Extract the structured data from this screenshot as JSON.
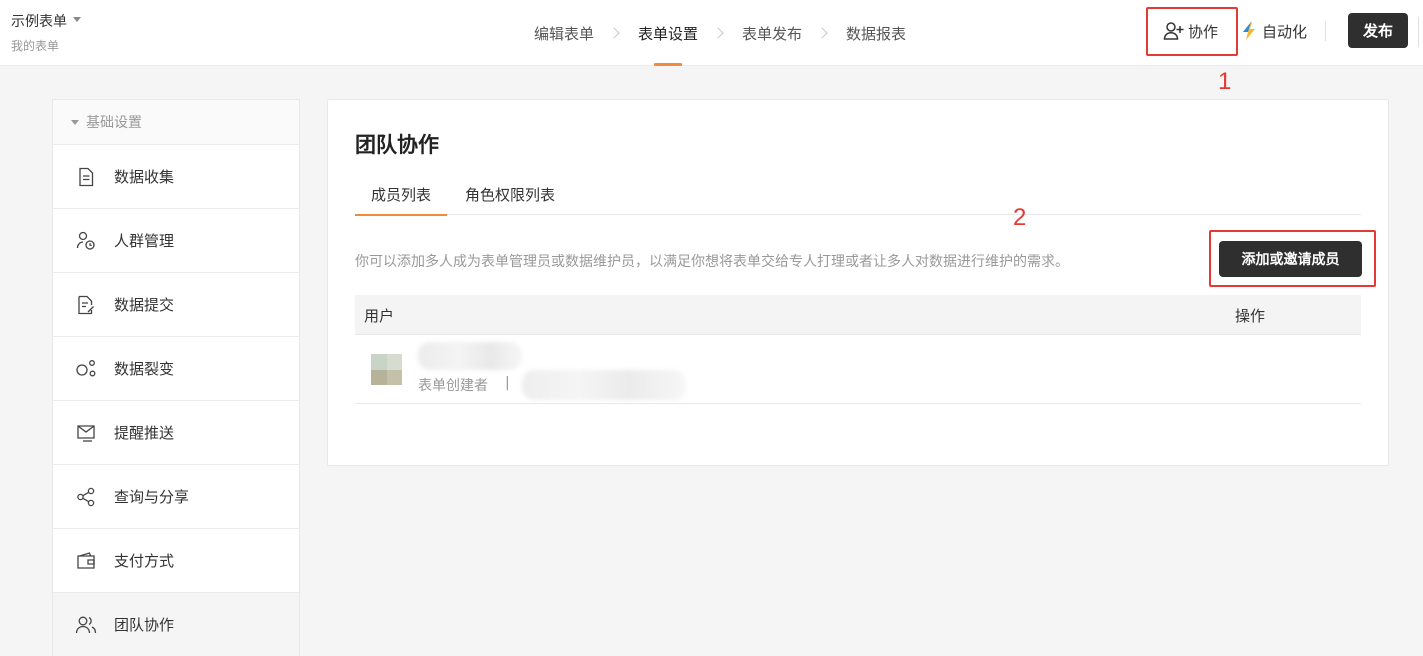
{
  "header": {
    "form_title": "示例表单",
    "form_subtitle": "我的表单",
    "steps": [
      "编辑表单",
      "表单设置",
      "表单发布",
      "数据报表"
    ],
    "active_step": "表单设置",
    "collab_label": "协作",
    "automation_label": "自动化",
    "publish_label": "发布"
  },
  "annotations": {
    "mark_1": "1",
    "mark_2": "2",
    "color": "#e53935"
  },
  "sidebar": {
    "group_label": "基础设置",
    "items": [
      {
        "label": "数据收集",
        "icon": "document-icon"
      },
      {
        "label": "人群管理",
        "icon": "user-clock-icon"
      },
      {
        "label": "数据提交",
        "icon": "document-edit-icon"
      },
      {
        "label": "数据裂变",
        "icon": "nodes-icon"
      },
      {
        "label": "提醒推送",
        "icon": "envelope-icon"
      },
      {
        "label": "查询与分享",
        "icon": "share-icon"
      },
      {
        "label": "支付方式",
        "icon": "wallet-icon"
      },
      {
        "label": "团队协作",
        "icon": "team-icon"
      }
    ],
    "active_item": "团队协作"
  },
  "main": {
    "title": "团队协作",
    "tabs": [
      {
        "label": "成员列表",
        "active": true
      },
      {
        "label": "角色权限列表",
        "active": false
      }
    ],
    "description": "你可以添加多人成为表单管理员或数据维护员，以满足你想将表单交给专人打理或者让多人对数据进行维护的需求。",
    "invite_label": "添加或邀请成员",
    "table": {
      "columns": [
        "用户",
        "操作"
      ],
      "rows": [
        {
          "role": "表单创建者",
          "separator": "|"
        }
      ]
    }
  },
  "colors": {
    "accent": "#f08a3e",
    "dark_button": "#2f2f2f",
    "highlight_box": "#e53935"
  }
}
